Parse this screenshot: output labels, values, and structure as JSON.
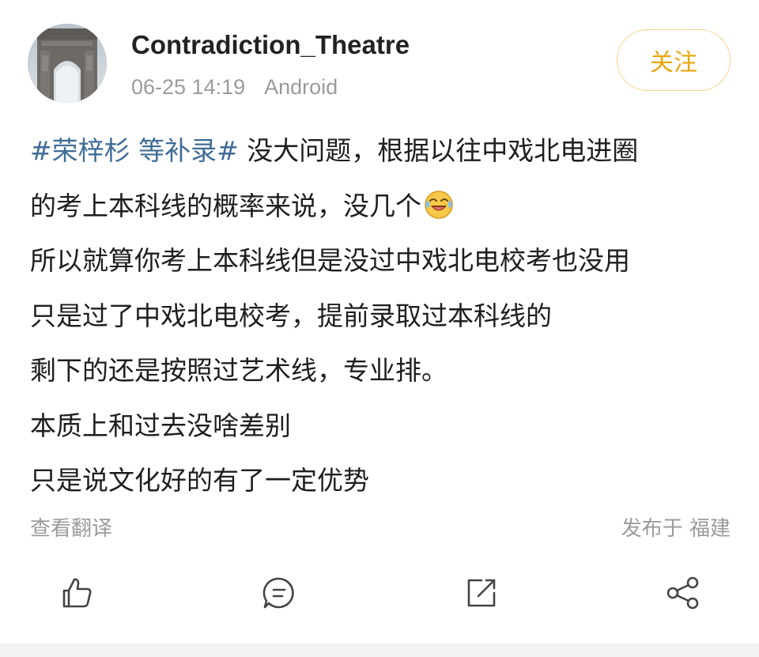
{
  "post": {
    "author": "Contradiction_Theatre",
    "time": "06-25 14:19",
    "source": "Android",
    "follow_label": "关注",
    "lines": [
      {
        "hashtag": "#荣梓杉 等补录#",
        "text": " 没大问题，根据以往中戏北电进圈"
      },
      {
        "text": "的考上本科线的概率来说，没几个",
        "emoji": "laughing-crying-face"
      },
      {
        "text": "所以就算你考上本科线但是没过中戏北电校考也没用"
      },
      {
        "text": "只是过了中戏北电校考，提前录取过本科线的"
      },
      {
        "text": "剩下的还是按照过艺术线，专业排。"
      },
      {
        "text": "本质上和过去没啥差别"
      },
      {
        "text": "只是说文化好的有了一定优势"
      }
    ],
    "translate_label": "查看翻译",
    "location_label": "发布于 福建"
  },
  "actions": [
    {
      "icon": "thumbs-up-icon",
      "name": "like-button"
    },
    {
      "icon": "comment-icon",
      "name": "comment-button"
    },
    {
      "icon": "repost-icon",
      "name": "repost-button"
    },
    {
      "icon": "share-icon",
      "name": "share-button"
    }
  ],
  "colors": {
    "text": "#1e1e1e",
    "meta": "#9b9b9b",
    "hashtag": "#3f6c96",
    "follow": "#e8a60f",
    "follow_border": "#f3d28c",
    "icon": "#444444"
  }
}
